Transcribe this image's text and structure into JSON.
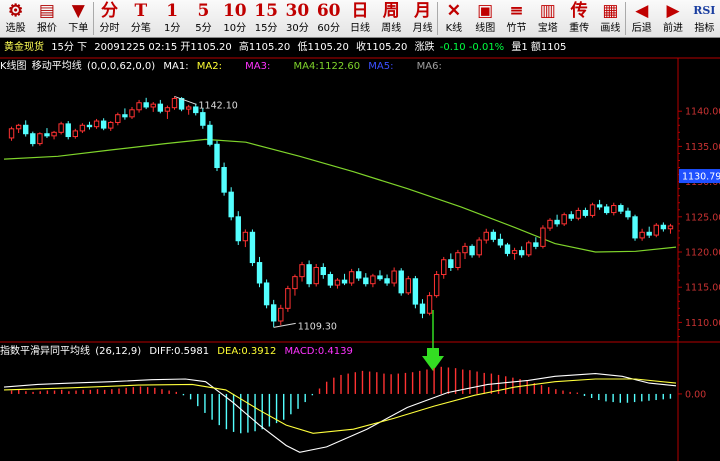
{
  "toolbar": {
    "buttons": [
      {
        "glyph": "⚙",
        "label": "选股",
        "color": "#b00000"
      },
      {
        "glyph": "▤",
        "label": "报价",
        "color": "#b00000"
      },
      {
        "glyph": "▼",
        "label": "下单",
        "color": "#b00000"
      },
      {
        "glyph": "分",
        "label": "分时",
        "color": "#c00000"
      },
      {
        "glyph": "T",
        "label": "分笔",
        "color": "#c00000"
      },
      {
        "glyph": "1",
        "label": "1分",
        "color": "#c00000"
      },
      {
        "glyph": "5",
        "label": "5分",
        "color": "#c00000"
      },
      {
        "glyph": "10",
        "label": "10分",
        "color": "#c00000"
      },
      {
        "glyph": "15",
        "label": "15分",
        "color": "#c00000"
      },
      {
        "glyph": "30",
        "label": "30分",
        "color": "#c00000"
      },
      {
        "glyph": "60",
        "label": "60分",
        "color": "#c00000"
      },
      {
        "glyph": "日",
        "label": "日线",
        "color": "#c00000"
      },
      {
        "glyph": "周",
        "label": "周线",
        "color": "#c00000"
      },
      {
        "glyph": "月",
        "label": "月线",
        "color": "#c00000"
      },
      {
        "glyph": "✕",
        "label": "K线",
        "color": "#c00000"
      },
      {
        "glyph": "▣",
        "label": "线图",
        "color": "#c00000"
      },
      {
        "glyph": "≡",
        "label": "竹节",
        "color": "#c00000"
      },
      {
        "glyph": "▥",
        "label": "宝塔",
        "color": "#c00000"
      },
      {
        "glyph": "传",
        "label": "重传",
        "color": "#c00000"
      },
      {
        "glyph": "▦",
        "label": "画线",
        "color": "#c00000"
      },
      {
        "glyph": "◀",
        "label": "后退",
        "color": "#c00000"
      },
      {
        "glyph": "▶",
        "label": "前进",
        "color": "#c00000"
      },
      {
        "glyph": "RSI",
        "label": "指标",
        "color": "#1a3ea0"
      }
    ]
  },
  "info": {
    "name": "黄金现货",
    "period": "15分 下",
    "time": "20091225 02:15",
    "open": "开1105.20",
    "high": "高1105.20",
    "low": "低1105.20",
    "close": "收1105.20",
    "change_label": "涨跌",
    "change": "-0.10 -0.01%",
    "volume": "量1 额1105"
  },
  "legend_main": {
    "chart_type": "K线图",
    "indicator": "移动平均线",
    "params": "(0,0,0,62,0,0)",
    "ma1": "MA1:",
    "ma2": "MA2:",
    "ma3": "MA3:",
    "ma4": "MA4:1122.60",
    "ma5": "MA5:",
    "ma6": "MA6:"
  },
  "legend_macd": {
    "indicator": "指数平滑异同平均线",
    "params": "(26,12,9)",
    "diff": "DIFF:0.5981",
    "dea": "DEA:0.3912",
    "macd": "MACD:0.4139"
  },
  "colors": {
    "up": "#ff3232",
    "down": "#54ffff",
    "ma4": "#7fd42b",
    "diff": "#ffffff",
    "dea": "#ffff3c",
    "axis": "#b40000",
    "price_box": "#1e50ff",
    "arrow": "#33dd22"
  },
  "chart_data": {
    "type": "candlestick",
    "y_ticks": [
      "1140.00",
      "1135.00",
      "1130.00",
      "1125.00",
      "1120.00",
      "1115.00",
      "1110.00"
    ],
    "macd_ticks": [
      "0.00"
    ],
    "ylim": [
      1107.5,
      1145
    ],
    "macd_ylim": [
      -9,
      5
    ],
    "current_price": "1130.79",
    "annotations": {
      "high": "1142.10",
      "low": "1109.30"
    },
    "candles": [
      [
        1136.2,
        1137.8,
        1135.8,
        1137.5
      ],
      [
        1137.5,
        1138.2,
        1136.9,
        1138.0
      ],
      [
        1138.0,
        1138.7,
        1136.4,
        1136.8
      ],
      [
        1136.8,
        1137.1,
        1135.0,
        1135.4
      ],
      [
        1135.4,
        1137.0,
        1135.1,
        1136.8
      ],
      [
        1136.8,
        1137.6,
        1136.2,
        1136.5
      ],
      [
        1136.5,
        1137.2,
        1136.0,
        1137.0
      ],
      [
        1137.0,
        1138.5,
        1136.7,
        1138.2
      ],
      [
        1138.2,
        1138.6,
        1136.0,
        1136.4
      ],
      [
        1136.4,
        1137.5,
        1136.1,
        1137.2
      ],
      [
        1137.2,
        1138.3,
        1136.9,
        1138.0
      ],
      [
        1138.0,
        1138.5,
        1137.4,
        1137.8
      ],
      [
        1137.8,
        1138.9,
        1137.5,
        1138.6
      ],
      [
        1138.6,
        1139.0,
        1137.3,
        1137.6
      ],
      [
        1137.6,
        1138.6,
        1137.2,
        1138.4
      ],
      [
        1138.4,
        1139.8,
        1138.0,
        1139.5
      ],
      [
        1139.5,
        1140.4,
        1138.8,
        1139.2
      ],
      [
        1139.2,
        1140.6,
        1138.9,
        1140.2
      ],
      [
        1140.2,
        1141.6,
        1139.8,
        1141.2
      ],
      [
        1141.2,
        1141.9,
        1140.3,
        1140.6
      ],
      [
        1140.6,
        1141.3,
        1139.9,
        1141.0
      ],
      [
        1141.0,
        1141.6,
        1139.7,
        1140.0
      ],
      [
        1140.0,
        1140.8,
        1138.9,
        1140.5
      ],
      [
        1140.5,
        1142.1,
        1140.2,
        1141.8
      ],
      [
        1141.8,
        1142.0,
        1140.0,
        1140.3
      ],
      [
        1140.3,
        1140.9,
        1139.5,
        1140.6
      ],
      [
        1140.6,
        1141.1,
        1139.4,
        1139.8
      ],
      [
        1139.8,
        1140.4,
        1137.5,
        1138.0
      ],
      [
        1138.0,
        1138.6,
        1135.0,
        1135.3
      ],
      [
        1135.3,
        1135.8,
        1131.5,
        1132.0
      ],
      [
        1132.0,
        1132.7,
        1128.0,
        1128.5
      ],
      [
        1128.5,
        1129.2,
        1124.5,
        1125.0
      ],
      [
        1125.0,
        1125.8,
        1121.0,
        1121.6
      ],
      [
        1121.6,
        1123.2,
        1120.7,
        1122.8
      ],
      [
        1122.8,
        1123.2,
        1118.0,
        1118.5
      ],
      [
        1118.5,
        1119.3,
        1115.0,
        1115.6
      ],
      [
        1115.6,
        1116.1,
        1112.0,
        1112.5
      ],
      [
        1112.5,
        1113.2,
        1109.3,
        1110.2
      ],
      [
        1110.2,
        1112.5,
        1109.6,
        1112.0
      ],
      [
        1112.0,
        1115.2,
        1111.5,
        1114.8
      ],
      [
        1114.8,
        1116.8,
        1113.8,
        1116.5
      ],
      [
        1116.5,
        1118.6,
        1115.8,
        1118.2
      ],
      [
        1118.2,
        1118.8,
        1115.0,
        1115.5
      ],
      [
        1115.5,
        1118.3,
        1115.1,
        1117.8
      ],
      [
        1117.8,
        1118.4,
        1116.2,
        1116.8
      ],
      [
        1116.8,
        1117.2,
        1114.9,
        1115.3
      ],
      [
        1115.3,
        1116.3,
        1114.8,
        1116.0
      ],
      [
        1116.0,
        1116.9,
        1115.3,
        1115.6
      ],
      [
        1115.6,
        1117.6,
        1115.2,
        1117.2
      ],
      [
        1117.2,
        1117.7,
        1115.9,
        1116.3
      ],
      [
        1116.3,
        1117.0,
        1115.1,
        1115.5
      ],
      [
        1115.5,
        1116.9,
        1115.0,
        1116.6
      ],
      [
        1116.6,
        1117.4,
        1115.9,
        1116.2
      ],
      [
        1116.2,
        1116.8,
        1115.2,
        1115.6
      ],
      [
        1115.6,
        1117.8,
        1115.1,
        1117.3
      ],
      [
        1117.3,
        1117.7,
        1113.8,
        1114.2
      ],
      [
        1114.2,
        1116.6,
        1113.9,
        1116.2
      ],
      [
        1116.2,
        1116.6,
        1112.0,
        1112.6
      ],
      [
        1112.6,
        1113.3,
        1110.6,
        1111.3
      ],
      [
        1111.3,
        1114.3,
        1111.0,
        1113.8
      ],
      [
        1113.8,
        1117.3,
        1113.5,
        1116.8
      ],
      [
        1116.8,
        1119.3,
        1116.2,
        1118.9
      ],
      [
        1118.9,
        1119.8,
        1117.3,
        1117.8
      ],
      [
        1117.8,
        1120.3,
        1117.4,
        1119.9
      ],
      [
        1119.9,
        1121.3,
        1119.0,
        1120.8
      ],
      [
        1120.8,
        1121.1,
        1119.2,
        1119.6
      ],
      [
        1119.6,
        1122.1,
        1119.2,
        1121.7
      ],
      [
        1121.7,
        1123.3,
        1121.2,
        1122.8
      ],
      [
        1122.8,
        1123.2,
        1121.4,
        1121.8
      ],
      [
        1121.8,
        1122.6,
        1120.6,
        1121.0
      ],
      [
        1121.0,
        1121.3,
        1119.4,
        1119.8
      ],
      [
        1119.8,
        1120.6,
        1118.9,
        1120.2
      ],
      [
        1120.2,
        1120.8,
        1119.2,
        1119.6
      ],
      [
        1119.6,
        1121.6,
        1119.3,
        1121.3
      ],
      [
        1121.3,
        1122.1,
        1120.4,
        1120.8
      ],
      [
        1120.8,
        1123.8,
        1120.5,
        1123.4
      ],
      [
        1123.4,
        1124.8,
        1123.0,
        1124.5
      ],
      [
        1124.5,
        1125.3,
        1123.6,
        1124.0
      ],
      [
        1124.0,
        1125.6,
        1123.7,
        1125.3
      ],
      [
        1125.3,
        1125.8,
        1124.4,
        1124.8
      ],
      [
        1124.8,
        1126.3,
        1124.5,
        1125.9
      ],
      [
        1125.9,
        1126.3,
        1124.9,
        1125.2
      ],
      [
        1125.2,
        1127.0,
        1124.9,
        1126.7
      ],
      [
        1126.7,
        1127.4,
        1126.0,
        1126.4
      ],
      [
        1126.4,
        1126.8,
        1125.3,
        1125.6
      ],
      [
        1125.6,
        1127.0,
        1125.2,
        1126.6
      ],
      [
        1126.6,
        1126.9,
        1125.4,
        1125.8
      ],
      [
        1125.8,
        1126.3,
        1124.6,
        1125.0
      ],
      [
        1125.0,
        1125.3,
        1121.6,
        1122.0
      ],
      [
        1122.0,
        1123.3,
        1121.6,
        1122.8
      ],
      [
        1122.8,
        1123.6,
        1122.0,
        1122.4
      ],
      [
        1122.4,
        1124.1,
        1122.1,
        1123.8
      ],
      [
        1123.8,
        1124.2,
        1122.9,
        1123.3
      ],
      [
        1123.3,
        1124.0,
        1122.6,
        1123.7
      ]
    ],
    "ma4": [
      [
        0,
        1133.2
      ],
      [
        0.08,
        1133.6
      ],
      [
        0.16,
        1134.5
      ],
      [
        0.24,
        1135.4
      ],
      [
        0.3,
        1136.0
      ],
      [
        0.36,
        1135.6
      ],
      [
        0.44,
        1133.6
      ],
      [
        0.52,
        1131.4
      ],
      [
        0.6,
        1129.0
      ],
      [
        0.68,
        1126.4
      ],
      [
        0.76,
        1123.5
      ],
      [
        0.82,
        1121.2
      ],
      [
        0.88,
        1120.0
      ],
      [
        0.94,
        1120.1
      ],
      [
        1.0,
        1120.7
      ]
    ],
    "macd_bars": [
      0.5,
      0.6,
      0.4,
      0.3,
      0.4,
      0.5,
      0.5,
      0.6,
      0.4,
      0.5,
      0.6,
      0.6,
      0.7,
      0.6,
      0.7,
      0.8,
      0.9,
      1.0,
      1.1,
      1.0,
      0.9,
      0.7,
      0.5,
      0.3,
      -0.2,
      -0.8,
      -1.8,
      -2.8,
      -3.8,
      -4.6,
      -5.2,
      -5.6,
      -5.8,
      -5.7,
      -5.5,
      -5.2,
      -4.8,
      -4.3,
      -3.8,
      -3.0,
      -2.2,
      -1.2,
      -0.2,
      0.8,
      1.8,
      2.4,
      2.8,
      3.0,
      3.2,
      3.4,
      3.3,
      3.2,
      3.0,
      2.9,
      3.0,
      3.1,
      3.2,
      3.4,
      3.6,
      3.8,
      4.0,
      3.9,
      3.8,
      3.6,
      3.5,
      3.3,
      3.1,
      3.0,
      2.8,
      2.6,
      2.4,
      2.2,
      1.9,
      1.6,
      1.3,
      1.0,
      0.7,
      0.5,
      0.3,
      0.2,
      -0.3,
      -0.6,
      -0.9,
      -1.1,
      -1.2,
      -1.3,
      -1.3,
      -1.2,
      -1.1,
      -1.0,
      -0.9,
      -0.8,
      -0.7
    ],
    "diff": [
      [
        0,
        1.0
      ],
      [
        0.05,
        1.4
      ],
      [
        0.1,
        1.6
      ],
      [
        0.16,
        1.8
      ],
      [
        0.22,
        2.1
      ],
      [
        0.27,
        2.2
      ],
      [
        0.3,
        1.8
      ],
      [
        0.34,
        -1.2
      ],
      [
        0.38,
        -4.6
      ],
      [
        0.42,
        -7.6
      ],
      [
        0.44,
        -8.6
      ],
      [
        0.48,
        -7.8
      ],
      [
        0.54,
        -5.2
      ],
      [
        0.6,
        -2.0
      ],
      [
        0.66,
        0.2
      ],
      [
        0.72,
        1.4
      ],
      [
        0.78,
        2.0
      ],
      [
        0.82,
        2.6
      ],
      [
        0.88,
        3.0
      ],
      [
        0.92,
        2.6
      ],
      [
        0.96,
        1.6
      ],
      [
        1.0,
        1.2
      ]
    ],
    "dea": [
      [
        0,
        0.6
      ],
      [
        0.1,
        0.9
      ],
      [
        0.2,
        1.3
      ],
      [
        0.28,
        1.4
      ],
      [
        0.33,
        0.6
      ],
      [
        0.38,
        -2.4
      ],
      [
        0.42,
        -4.6
      ],
      [
        0.46,
        -5.8
      ],
      [
        0.52,
        -5.2
      ],
      [
        0.58,
        -3.6
      ],
      [
        0.64,
        -1.8
      ],
      [
        0.7,
        -0.2
      ],
      [
        0.76,
        1.0
      ],
      [
        0.82,
        1.8
      ],
      [
        0.88,
        2.2
      ],
      [
        0.94,
        2.2
      ],
      [
        1.0,
        1.6
      ]
    ]
  }
}
